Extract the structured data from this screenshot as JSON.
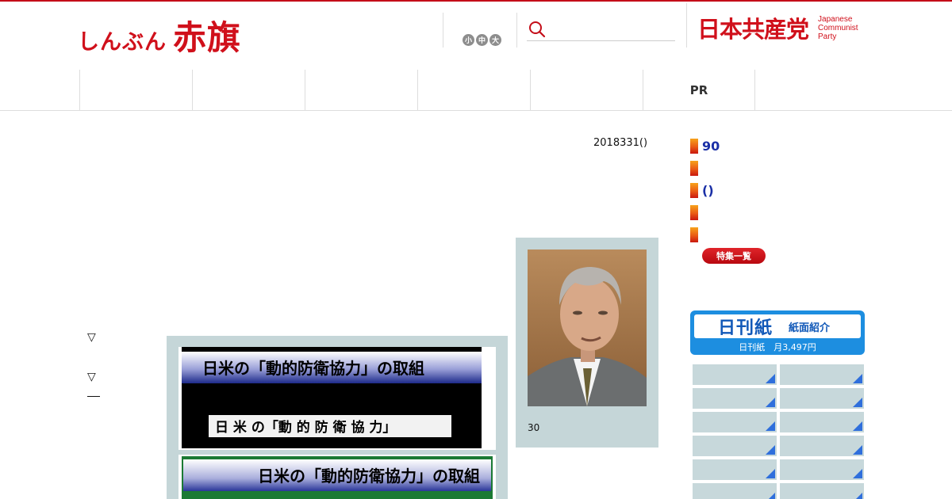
{
  "header": {
    "logo_kana": "しんぶん",
    "logo_kanji": "赤旗",
    "font_size_buttons": [
      "小",
      "中",
      "大"
    ],
    "search_placeholder": "",
    "party_name_jp": "日本共産党",
    "party_name_en": [
      "Japanese",
      "Communist",
      "Party"
    ]
  },
  "nav": {
    "items": [
      "",
      "",
      "",
      "",
      "",
      "PR",
      ""
    ]
  },
  "article": {
    "date": "2018331()",
    "photo_caption": "30",
    "bullets": [
      "▽",
      "▽"
    ],
    "figure_title": "日米の「動的防衛協力」の取組",
    "figure_subtitle": "日 米 の「動 的 防 衛 協 力」"
  },
  "sidebar": {
    "links": [
      "90",
      "",
      "()",
      "",
      ""
    ],
    "feature_button": "特集一覧",
    "banner": {
      "title": "日刊紙",
      "subtitle": "紙面紹介",
      "price": "日刊紙　月3,497円"
    },
    "tile_count_note": ""
  },
  "colors": {
    "brand_red": "#d0101b",
    "link_blue": "#1a2fa6",
    "panel_bg": "#c5d6d8",
    "banner_blue": "#1d8ee0"
  },
  "icons": {
    "search": "search-icon",
    "link_marker": "orange-bar-icon",
    "tile_corner": "blue-corner-triangle-icon"
  }
}
